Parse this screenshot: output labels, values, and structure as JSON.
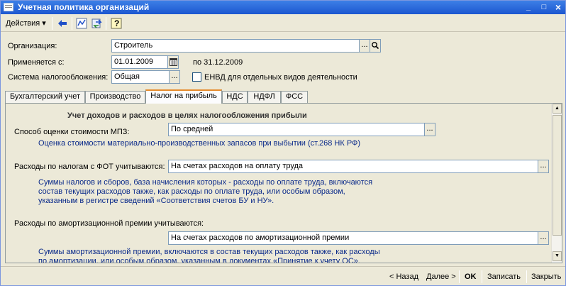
{
  "window": {
    "title": "Учетная политика организаций",
    "controls": {
      "minimize": "_",
      "maximize": "□",
      "close": "×"
    }
  },
  "toolbar": {
    "actions_label": "Действия",
    "icons": [
      "back-arrow-icon",
      "structure-icon",
      "refresh-icon",
      "help-icon"
    ],
    "help_glyph": "?"
  },
  "form": {
    "organization": {
      "label": "Организация:",
      "value": "Строитель",
      "select_glyph": "...",
      "search_icon": "magnifier-icon"
    },
    "applies_from": {
      "label": "Применяется с:",
      "value": "01.01.2009",
      "until_text": "по 31.12.2009",
      "calendar_icon": "calendar-icon"
    },
    "tax_system": {
      "label": "Система налогообложения:",
      "value": "Общая",
      "select_glyph": "..."
    },
    "envd": {
      "label": "ЕНВД для отдельных видов деятельности",
      "checked": false
    }
  },
  "tabs": [
    {
      "label": "Бухгалтерский учет",
      "active": false
    },
    {
      "label": "Производство",
      "active": false
    },
    {
      "label": "Налог на прибыль",
      "active": true
    },
    {
      "label": "НДС",
      "active": false
    },
    {
      "label": "НДФЛ",
      "active": false
    },
    {
      "label": "ФСС",
      "active": false
    }
  ],
  "panel": {
    "heading": "Учет доходов и расходов в целях налогообложения прибыли",
    "mpz": {
      "label": "Способ оценки стоимости МПЗ:",
      "value": "По средней",
      "note": "Оценка стоимости материально-производственных запасов при выбытии (ст.268 НК РФ)"
    },
    "fot": {
      "label": "Расходы по налогам с ФОТ учитываются:",
      "value": "На счетах расходов на оплату труда",
      "note_lines": [
        "Суммы налогов и сборов, база начисления которых - расходы по оплате труда, включаются",
        "состав текущих расходов также, как расходы по оплате труда, или особым образом,",
        "указанным в регистре сведений «Соответствия счетов БУ и НУ»."
      ]
    },
    "amort": {
      "label": "Расходы по амортизационной премии учитываются:",
      "value": "На счетах расходов по амортизационной премии",
      "note_lines": [
        "Суммы амортизационной премии, включаются в состав текущих расходов также, как расходы",
        "по амортизации, или особым образом, указанным в документах «Принятие к учету ОС»."
      ]
    },
    "select_glyph": "..."
  },
  "statusbar": {
    "back": "< Назад",
    "next": "Далее >",
    "ok": "OK",
    "save": "Записать",
    "close": "Закрыть"
  }
}
